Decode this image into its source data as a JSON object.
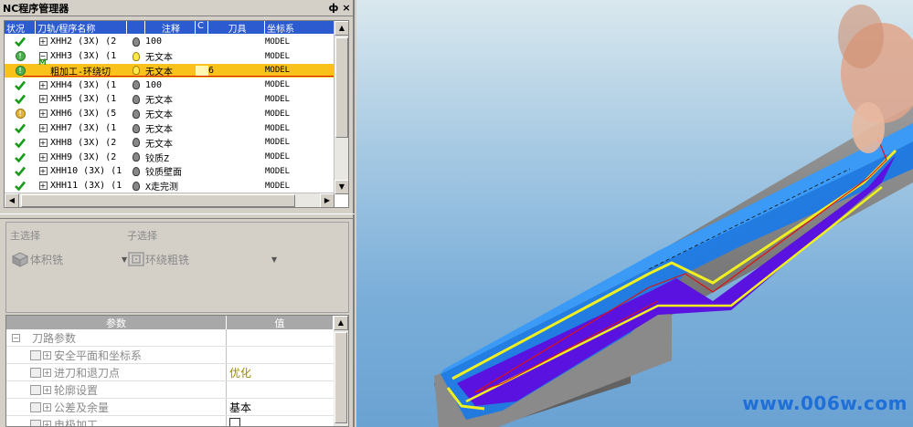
{
  "panel": {
    "title": "NC程序管理器",
    "pin": "ф",
    "close": "×"
  },
  "tree": {
    "headers": {
      "status": "状况",
      "name": "刀轨/程序名称",
      "note": "注释",
      "c": "C",
      "tool": "刀具",
      "coord": "坐标系"
    },
    "rows": [
      {
        "status": "check",
        "expander": "+",
        "name": "XHH2 (3X) (2",
        "bulb": "off",
        "note": "100",
        "tool": "",
        "coord": "MODEL"
      },
      {
        "status": "warn-green",
        "expander": "−",
        "name": "XHH3 (3X) (1",
        "bulb": "on",
        "note": "无文本",
        "tool": "",
        "coord": "MODEL"
      },
      {
        "status": "warn-green",
        "expander": "",
        "name": "粗加工-环绕切",
        "bulb": "on",
        "note": "无文本",
        "tool": "6",
        "coord": "MODEL",
        "selected": true,
        "marker": "M"
      },
      {
        "status": "check",
        "expander": "+",
        "name": "XHH4 (3X) (1",
        "bulb": "off",
        "note": "100",
        "tool": "",
        "coord": "MODEL"
      },
      {
        "status": "check",
        "expander": "+",
        "name": "XHH5 (3X) (1",
        "bulb": "off",
        "note": "无文本",
        "tool": "",
        "coord": "MODEL"
      },
      {
        "status": "warn-yellow",
        "expander": "+",
        "name": "XHH6 (3X) (5",
        "bulb": "off",
        "note": "无文本",
        "tool": "",
        "coord": "MODEL"
      },
      {
        "status": "check",
        "expander": "+",
        "name": "XHH7 (3X) (1",
        "bulb": "off",
        "note": "无文本",
        "tool": "",
        "coord": "MODEL"
      },
      {
        "status": "check",
        "expander": "+",
        "name": "XHH8 (3X) (2",
        "bulb": "off",
        "note": "无文本",
        "tool": "",
        "coord": "MODEL"
      },
      {
        "status": "check",
        "expander": "+",
        "name": "XHH9 (3X) (2",
        "bulb": "off",
        "note": "铰质Z",
        "tool": "",
        "coord": "MODEL"
      },
      {
        "status": "check",
        "expander": "+",
        "name": "XHH10 (3X) (1",
        "bulb": "off",
        "note": "铰质壁面",
        "tool": "",
        "coord": "MODEL"
      },
      {
        "status": "check",
        "expander": "+",
        "name": "XHH11 (3X) (1",
        "bulb": "off",
        "note": "X走完测",
        "tool": "",
        "coord": "MODEL"
      }
    ]
  },
  "selection": {
    "main_label": "主选择",
    "main_value": "体积铣",
    "sub_label": "子选择",
    "sub_value": "环绕粗铣"
  },
  "params": {
    "header_param": "参数",
    "header_value": "值",
    "rows": [
      {
        "label": "刀路参数",
        "value": "",
        "kind": "section"
      },
      {
        "label": "安全平面和坐标系",
        "value": "",
        "kind": "item"
      },
      {
        "label": "进刀和退刀点",
        "value": "优化",
        "kind": "item",
        "value_style": "olive"
      },
      {
        "label": "轮廓设置",
        "value": "",
        "kind": "item"
      },
      {
        "label": "公差及余量",
        "value": "基本",
        "kind": "item"
      },
      {
        "label": "电极加工",
        "value": "",
        "kind": "item",
        "checkbox": true
      }
    ]
  },
  "viewport": {
    "watermark": "www.006w.com"
  },
  "colors": {
    "selected_row": "#f9c21a",
    "header_blue": "#2c5bd0",
    "model_blue": "#1d7fe0",
    "toolpath_purple": "#5a12e0",
    "toolpath_yellow": "#f0f020"
  }
}
